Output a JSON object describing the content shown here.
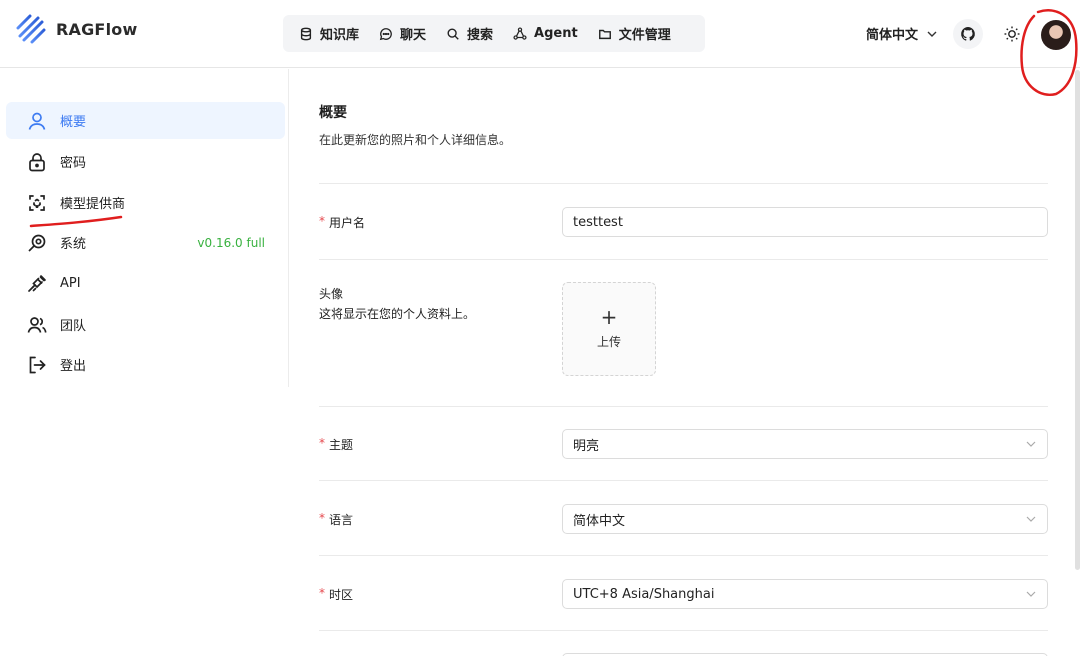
{
  "header": {
    "app_name": "RAGFlow",
    "nav": [
      {
        "label": "知识库",
        "icon": "database-icon"
      },
      {
        "label": "聊天",
        "icon": "chat-icon"
      },
      {
        "label": "搜索",
        "icon": "search-icon"
      },
      {
        "label": "Agent",
        "icon": "agent-icon"
      },
      {
        "label": "文件管理",
        "icon": "folder-icon"
      }
    ],
    "language": "简体中文",
    "icons": {
      "github": "github-icon",
      "theme": "sun-icon",
      "avatar": "avatar"
    }
  },
  "sidebar": {
    "items": [
      {
        "label": "概要",
        "icon": "user-icon",
        "active": true
      },
      {
        "label": "密码",
        "icon": "lock-icon"
      },
      {
        "label": "模型提供商",
        "icon": "model-provider-icon"
      },
      {
        "label": "系统",
        "icon": "system-icon"
      },
      {
        "label": "API",
        "icon": "plug-icon"
      },
      {
        "label": "团队",
        "icon": "team-icon"
      },
      {
        "label": "登出",
        "icon": "logout-icon"
      }
    ],
    "version": "v0.16.0 full"
  },
  "main": {
    "title": "概要",
    "description": "在此更新您的照片和个人详细信息。",
    "username": {
      "label": "用户名",
      "value": "testtest"
    },
    "avatar_field": {
      "label": "头像",
      "hint": "这将显示在您的个人资料上。",
      "upload_plus": "+",
      "upload_label": "上传"
    },
    "theme": {
      "label": "主题",
      "value": "明亮"
    },
    "language": {
      "label": "语言",
      "value": "简体中文"
    },
    "timezone": {
      "label": "时区",
      "value": "UTC+8 Asia/Shanghai"
    }
  },
  "colors": {
    "accent": "#3d7bf2",
    "version": "#38b13f",
    "required": "#e5484d",
    "annotation": "#e01e1e"
  }
}
